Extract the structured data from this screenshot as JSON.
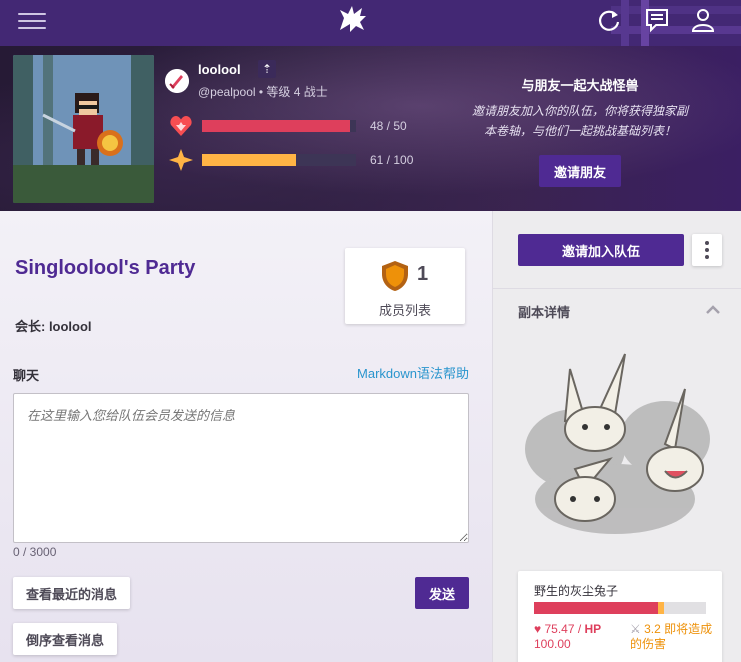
{
  "colors": {
    "brand_purple": "#4f2a93",
    "nav_bg": "#432874",
    "health_red": "#de3f5c",
    "exp_yellow": "#ffb445",
    "link_blue": "#2995cd",
    "damage_orange": "#ee9109"
  },
  "nav": {
    "icons": [
      "menu-icon",
      "gryphon-logo-icon",
      "sync-icon",
      "messages-icon",
      "user-icon"
    ]
  },
  "member": {
    "username": "loolool",
    "handle_line": "@pealpool • 等级 4 战士",
    "health": {
      "current": 48,
      "max": 50,
      "label": "48 / 50"
    },
    "experience": {
      "current": 61,
      "max": 100,
      "label": "61 / 100"
    }
  },
  "invite": {
    "title": "与朋友一起大战怪兽",
    "text": "邀请朋友加入你的队伍，你将获得独家副本卷轴，与他们一起挑战基础列表！",
    "button": "邀请朋友"
  },
  "party": {
    "name": "Singloolool's Party",
    "leader": "会长: loolool",
    "member_count": "1",
    "members_label": "成员列表"
  },
  "chat": {
    "label": "聊天",
    "markdown_help": "Markdown语法帮助",
    "placeholder": "在这里输入您给队伍会员发送的信息",
    "char_count": "0 / 3000",
    "recent_button": "查看最近的消息",
    "reverse_button": "倒序查看消息",
    "send_button": "发送"
  },
  "sidebar": {
    "join_button": "邀请加入队伍",
    "quest_details": "副本详情",
    "boss": {
      "name": "野生的灰尘兔子",
      "hp_current": 75.47,
      "hp_max": 100,
      "hp_value": "75.47 /",
      "hp_label": "HP",
      "hp_max_text": "100.00",
      "rage_value": 3.2,
      "damage_text": "3.2 即将造成的伤害"
    }
  }
}
